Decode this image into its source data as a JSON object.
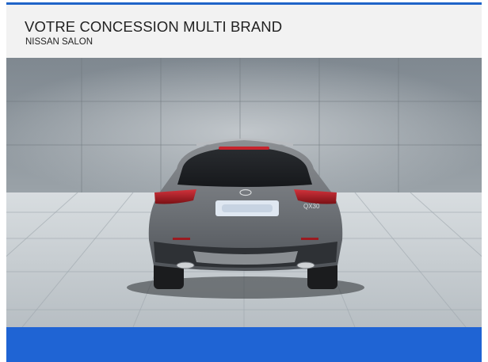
{
  "header": {
    "title": "VOTRE CONCESSION MULTI BRAND",
    "subtitle": "NISSAN SALON"
  },
  "photo": {
    "subject": "car-rear-view",
    "car_badge": "QX30"
  },
  "colors": {
    "accent": "#1f64d4",
    "header_bg": "#f2f2f2"
  }
}
